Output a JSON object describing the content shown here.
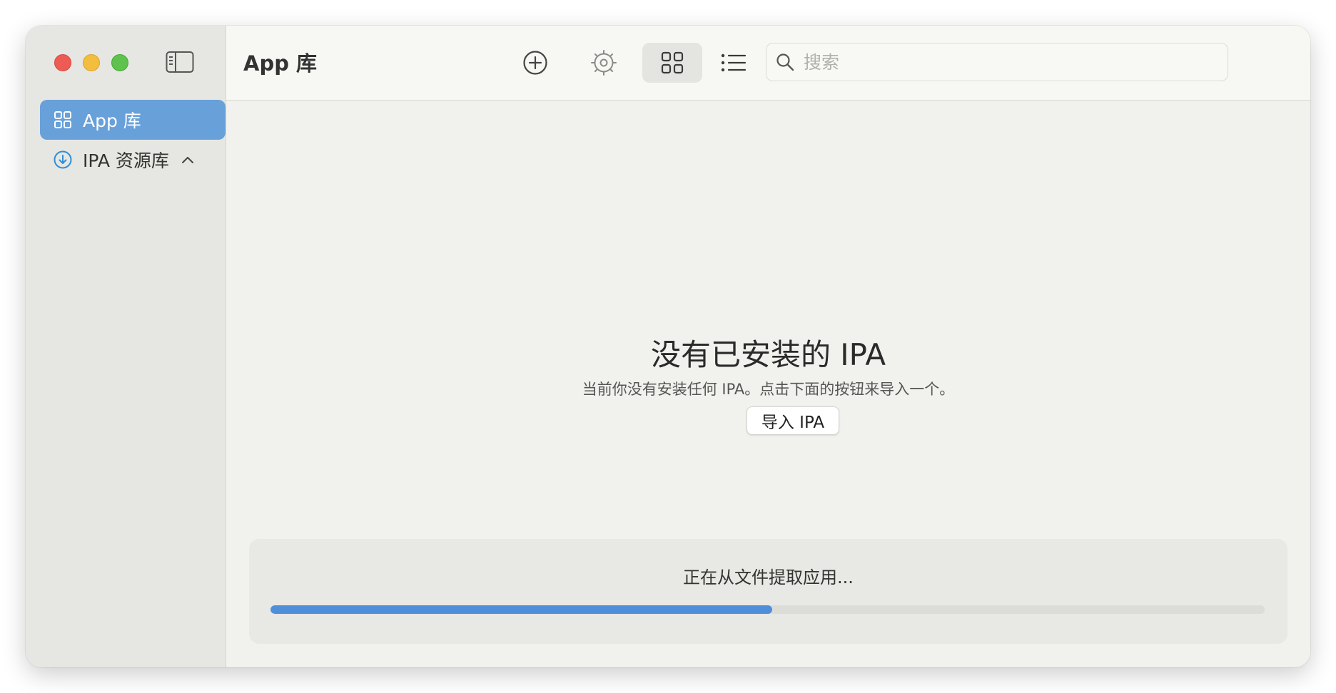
{
  "window": {
    "controls": [
      "close",
      "minimize",
      "zoom"
    ]
  },
  "sidebar": {
    "toggle_icon": "sidebar-toggle-icon",
    "items": [
      {
        "label": "App 库",
        "icon": "grid-icon",
        "active": true
      },
      {
        "label": "IPA 资源库",
        "icon": "download-circle-icon",
        "expanded": true
      }
    ]
  },
  "toolbar": {
    "title": "App 库",
    "buttons": [
      {
        "name": "add",
        "icon": "plus-circle-icon"
      },
      {
        "name": "settings",
        "icon": "gear-icon"
      },
      {
        "name": "grid-view",
        "icon": "grid-view-icon",
        "selected": true
      },
      {
        "name": "list-view",
        "icon": "list-view-icon"
      }
    ],
    "search": {
      "placeholder": "搜索",
      "value": ""
    }
  },
  "empty_state": {
    "title": "没有已安装的 IPA",
    "subtitle": "当前你没有安装任何 IPA。点击下面的按钮来导入一个。",
    "import_button": "导入 IPA"
  },
  "progress": {
    "label": "正在从文件提取应用...",
    "value": 0.505
  },
  "colors": {
    "accent": "#68a0da",
    "progress": "#4f8fda",
    "close": "#ee5b55",
    "minimize": "#f3bd3d",
    "zoom": "#5ec24c"
  }
}
